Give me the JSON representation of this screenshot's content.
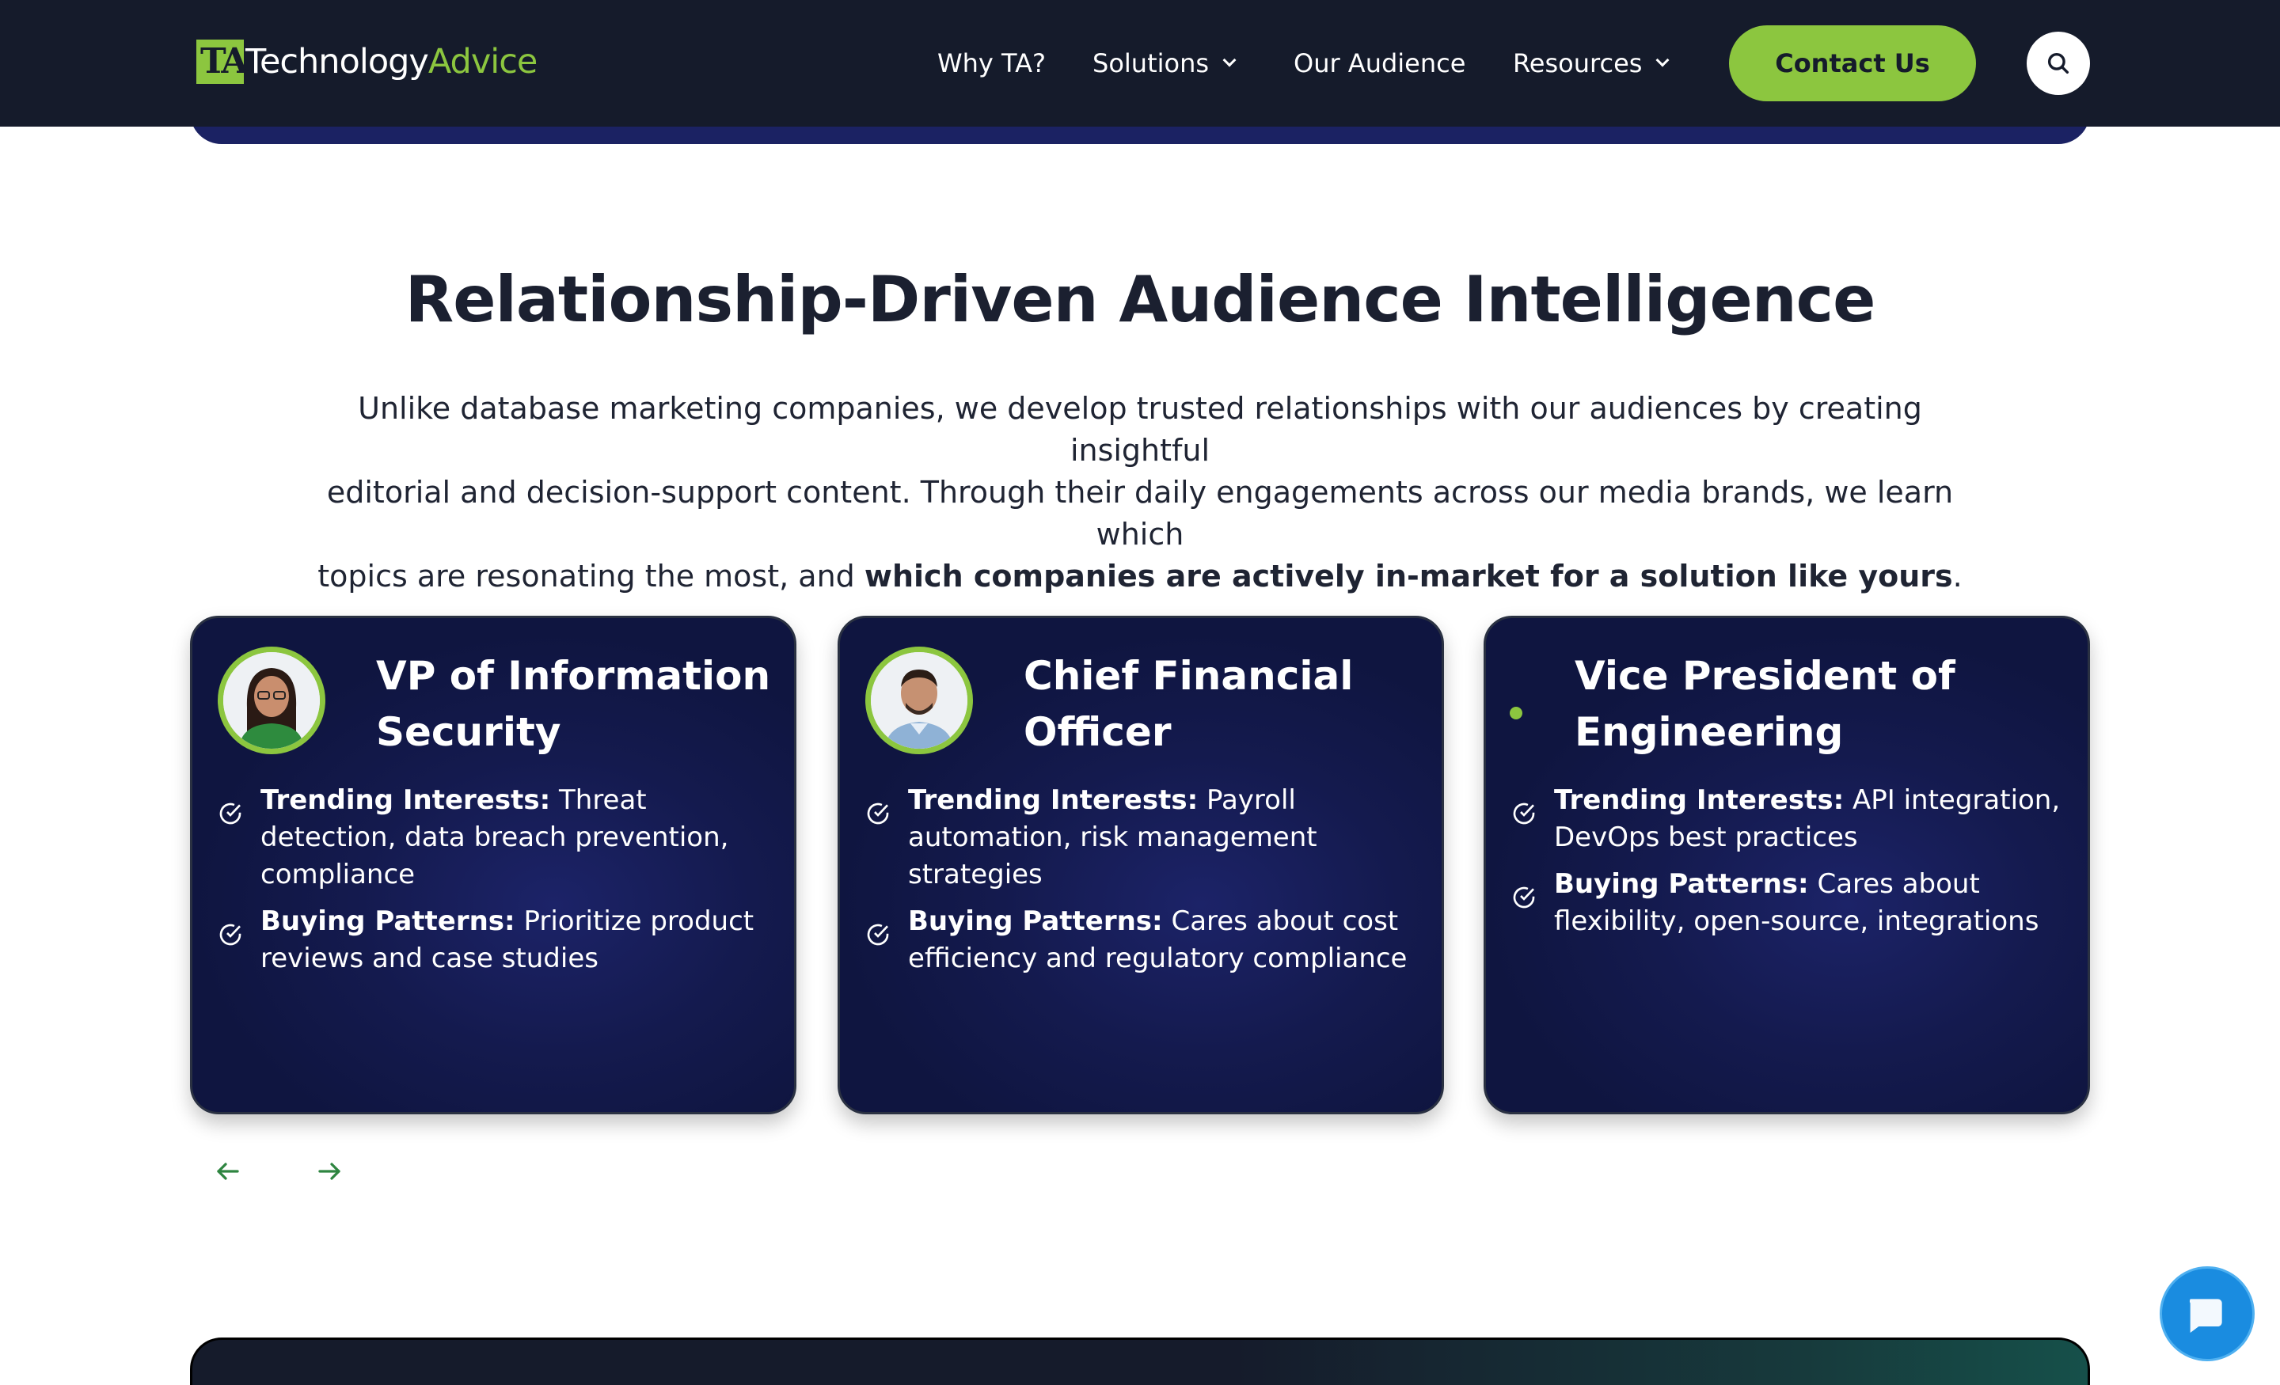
{
  "header": {
    "logo": {
      "mark": "TA",
      "text_primary": "Technology",
      "text_accent": "Advice"
    },
    "nav": [
      {
        "label": "Why TA?",
        "dropdown": false
      },
      {
        "label": "Solutions",
        "dropdown": true
      },
      {
        "label": "Our Audience",
        "dropdown": false
      },
      {
        "label": "Resources",
        "dropdown": true
      }
    ],
    "contact_label": "Contact Us",
    "search_icon": "search-icon"
  },
  "section": {
    "title_regular": "Relationship-Driven ",
    "title_bold": "Audience Intelligence",
    "intro_line1": "Unlike database marketing companies, we develop trusted relationships with our audiences by creating insightful",
    "intro_line2": "editorial and decision-support content. Through their daily engagements across our media brands, we learn which",
    "intro_line3_start": "topics are resonating the most, and ",
    "intro_line3_bold": "which companies are actively in-market for a solution like yours",
    "intro_line3_end": "."
  },
  "cards": [
    {
      "title": "VP of Information Security",
      "avatar": "avatar-woman",
      "bullets": [
        {
          "label": "Trending Interests:",
          "text": " Threat detection, data breach prevention, compliance"
        },
        {
          "label": "Buying Patterns:",
          "text": " Prioritize product reviews and case studies"
        }
      ]
    },
    {
      "title": "Chief Financial Officer",
      "avatar": "avatar-man",
      "bullets": [
        {
          "label": "Trending Interests:",
          "text": " Payroll automation, risk management strategies"
        },
        {
          "label": "Buying Patterns:",
          "text": " Cares about cost efficiency and regulatory compliance"
        }
      ]
    },
    {
      "title": "Vice President of Engineering",
      "avatar": "none",
      "bullets": [
        {
          "label": "Trending Interests:",
          "text": " API integration, DevOps best practices"
        },
        {
          "label": "Buying Patterns:",
          "text": " Cares about flexibility, open-source, integrations"
        }
      ]
    }
  ],
  "carousel": {
    "prev_icon": "arrow-left-icon",
    "next_icon": "arrow-right-icon"
  },
  "colors": {
    "brand_dark": "#151b2b",
    "brand_green": "#8cc63f",
    "card_navy": "#141a4e",
    "chat_blue": "#1a8ce0",
    "arrow_green": "#2e8540"
  }
}
